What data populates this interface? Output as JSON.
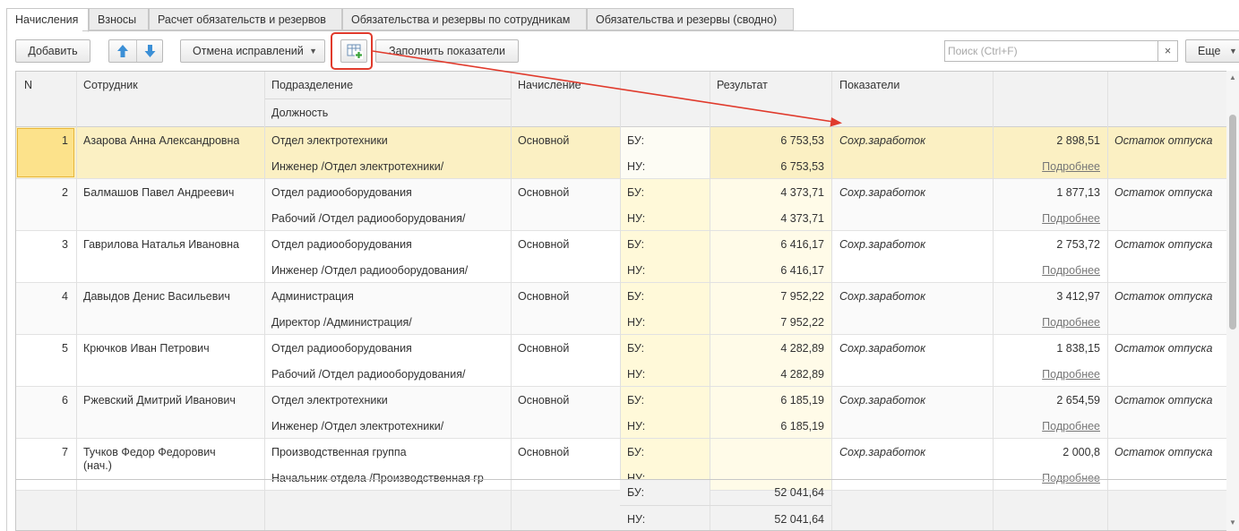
{
  "tabs": [
    "Начисления",
    "Взносы",
    "Расчет обязательств и резервов",
    "Обязательства и резервы по сотрудникам",
    "Обязательства и резервы (сводно)"
  ],
  "toolbar": {
    "add": "Добавить",
    "cancel_fix": "Отмена исправлений",
    "fill": "Заполнить показатели",
    "search_placeholder": "Поиск (Ctrl+F)",
    "clear": "×",
    "more": "Еще"
  },
  "columns": {
    "n": "N",
    "employee": "Сотрудник",
    "department": "Подразделение",
    "position": "Должность",
    "accrual": "Начисление",
    "result": "Результат",
    "indicators": "Показатели"
  },
  "rows": [
    {
      "n": "1",
      "name": "Азарова Анна Александровна",
      "name2": "",
      "dept": "Отдел электротехники",
      "pos": "Инженер /Отдел электротехники/",
      "acc": "Основной",
      "bu": "БУ:",
      "nu": "НУ:",
      "res_bu": "6 753,53",
      "res_nu": "6 753,53",
      "ind": "Сохр.заработок",
      "val": "2 898,51",
      "more": "Подробнее",
      "note": "Остаток отпуска"
    },
    {
      "n": "2",
      "name": "Балмашов Павел Андреевич",
      "name2": "",
      "dept": "Отдел радиооборудования",
      "pos": "Рабочий /Отдел радиооборудования/",
      "acc": "Основной",
      "bu": "БУ:",
      "nu": "НУ:",
      "res_bu": "4 373,71",
      "res_nu": "4 373,71",
      "ind": "Сохр.заработок",
      "val": "1 877,13",
      "more": "Подробнее",
      "note": "Остаток отпуска"
    },
    {
      "n": "3",
      "name": "Гаврилова Наталья Ивановна",
      "name2": "",
      "dept": "Отдел радиооборудования",
      "pos": "Инженер /Отдел радиооборудования/",
      "acc": "Основной",
      "bu": "БУ:",
      "nu": "НУ:",
      "res_bu": "6 416,17",
      "res_nu": "6 416,17",
      "ind": "Сохр.заработок",
      "val": "2 753,72",
      "more": "Подробнее",
      "note": "Остаток отпуска"
    },
    {
      "n": "4",
      "name": "Давыдов Денис Васильевич",
      "name2": "",
      "dept": "Администрация",
      "pos": "Директор /Администрация/",
      "acc": "Основной",
      "bu": "БУ:",
      "nu": "НУ:",
      "res_bu": "7 952,22",
      "res_nu": "7 952,22",
      "ind": "Сохр.заработок",
      "val": "3 412,97",
      "more": "Подробнее",
      "note": "Остаток отпуска"
    },
    {
      "n": "5",
      "name": "Крючков Иван Петрович",
      "name2": "",
      "dept": "Отдел радиооборудования",
      "pos": "Рабочий /Отдел радиооборудования/",
      "acc": "Основной",
      "bu": "БУ:",
      "nu": "НУ:",
      "res_bu": "4 282,89",
      "res_nu": "4 282,89",
      "ind": "Сохр.заработок",
      "val": "1 838,15",
      "more": "Подробнее",
      "note": "Остаток отпуска"
    },
    {
      "n": "6",
      "name": "Ржевский Дмитрий Иванович",
      "name2": "",
      "dept": "Отдел электротехники",
      "pos": "Инженер /Отдел электротехники/",
      "acc": "Основной",
      "bu": "БУ:",
      "nu": "НУ:",
      "res_bu": "6 185,19",
      "res_nu": "6 185,19",
      "ind": "Сохр.заработок",
      "val": "2 654,59",
      "more": "Подробнее",
      "note": "Остаток отпуска"
    },
    {
      "n": "7",
      "name": "Тучков Федор Федорович",
      "name2": "(нач.)",
      "dept": "Производственная группа",
      "pos": "Начальник отдела /Производственная гр",
      "acc": "Основной",
      "bu": "БУ:",
      "nu": "НУ:",
      "res_bu": "",
      "res_nu": "",
      "ind": "Сохр.заработок",
      "val": "2 000,8",
      "more": "Подробнее",
      "note": "Остаток отпуска"
    }
  ],
  "footer": {
    "bu": "БУ:",
    "nu": "НУ:",
    "total_bu": "52 041,64",
    "total_nu": "52 041,64"
  }
}
